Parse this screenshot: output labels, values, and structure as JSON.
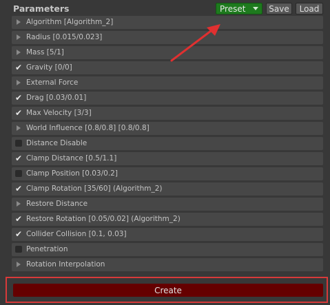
{
  "header": {
    "title": "Parameters",
    "preset_label": "Preset",
    "save_label": "Save",
    "load_label": "Load"
  },
  "rows": [
    {
      "label": "Algorithm [Algorithm_2]",
      "kind": "foldout"
    },
    {
      "label": "Radius [0.015/0.023]",
      "kind": "foldout"
    },
    {
      "label": "Mass [5/1]",
      "kind": "foldout"
    },
    {
      "label": "Gravity [0/0]",
      "kind": "checked"
    },
    {
      "label": "External Force",
      "kind": "foldout"
    },
    {
      "label": "Drag [0.03/0.01]",
      "kind": "checked"
    },
    {
      "label": "Max Velocity [3/3]",
      "kind": "checked"
    },
    {
      "label": "World Influence [0.8/0.8] [0.8/0.8]",
      "kind": "foldout"
    },
    {
      "label": "Distance Disable",
      "kind": "unchecked"
    },
    {
      "label": "Clamp Distance [0.5/1.1]",
      "kind": "checked"
    },
    {
      "label": "Clamp Position [0.03/0.2]",
      "kind": "unchecked"
    },
    {
      "label": "Clamp Rotation [35/60] (Algorithm_2)",
      "kind": "checked"
    },
    {
      "label": "Restore Distance",
      "kind": "foldout"
    },
    {
      "label": "Restore Rotation [0.05/0.02] (Algorithm_2)",
      "kind": "checked"
    },
    {
      "label": "Collider Collision [0.1, 0.03]",
      "kind": "checked"
    },
    {
      "label": "Penetration",
      "kind": "unchecked"
    },
    {
      "label": "Rotation Interpolation",
      "kind": "foldout"
    }
  ],
  "footer": {
    "create_label": "Create"
  },
  "colors": {
    "background": "#383838",
    "row": "#474747",
    "preset_green": "#1e7a1e",
    "create_red": "#650000",
    "annotation_red": "#d83a3a"
  },
  "icons": {
    "foldout": "triangle-right-icon",
    "checked": "checkmark-icon",
    "unchecked": "empty-checkbox-icon",
    "dropdown": "chevron-down-icon"
  }
}
